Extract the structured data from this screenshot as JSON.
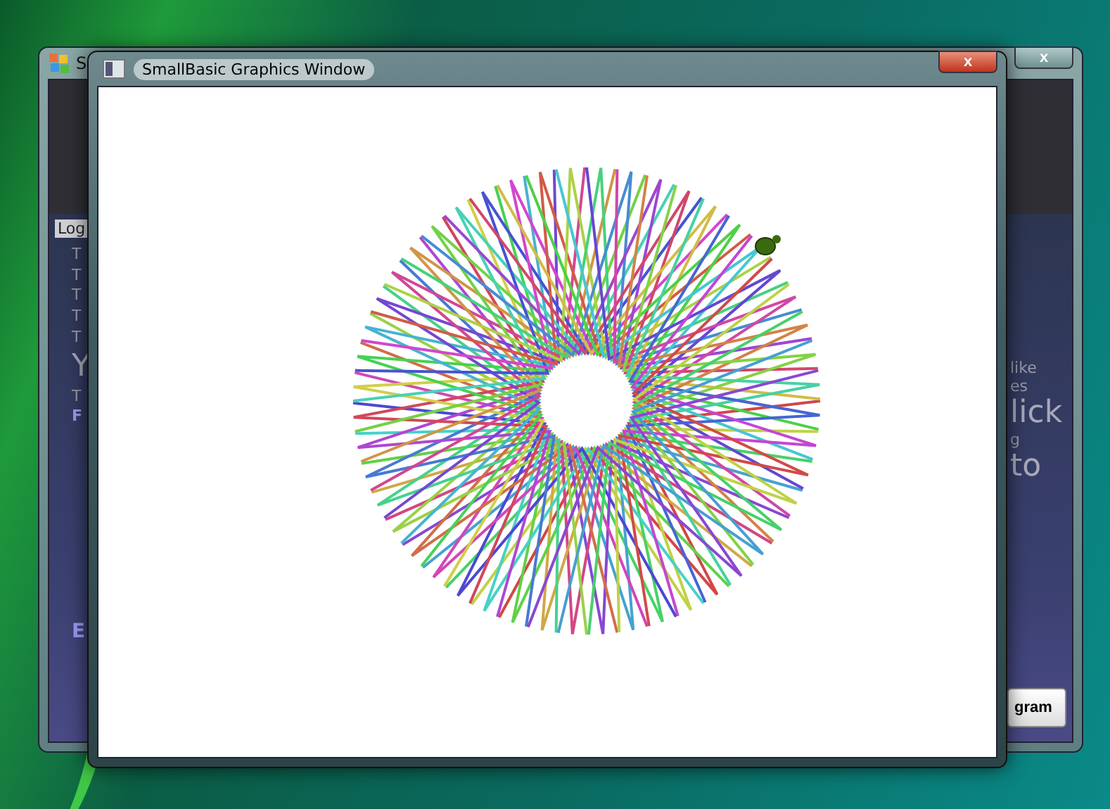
{
  "back_window": {
    "title": "S",
    "close_label": "x",
    "log_label": "Log",
    "left_lines": [
      {
        "text": "T",
        "kind": "small"
      },
      {
        "text": "T",
        "kind": "small"
      },
      {
        "text": "T",
        "kind": "small"
      },
      {
        "text": "T",
        "kind": "small"
      },
      {
        "text": "T",
        "kind": "small"
      },
      {
        "text": "Y",
        "kind": "large"
      },
      {
        "text": "T",
        "kind": "small"
      },
      {
        "text": "F",
        "kind": "link"
      }
    ],
    "left_footer": "E",
    "right_lines": [
      {
        "text": "like",
        "kind": "small"
      },
      {
        "text": "es",
        "kind": "small"
      },
      {
        "text": "lick",
        "kind": "large"
      },
      {
        "text": "g",
        "kind": "small"
      },
      {
        "text": "to",
        "kind": "large"
      }
    ],
    "button": "gram"
  },
  "graphics_window": {
    "title": "SmallBasic Graphics Window",
    "close_label": "x"
  }
}
